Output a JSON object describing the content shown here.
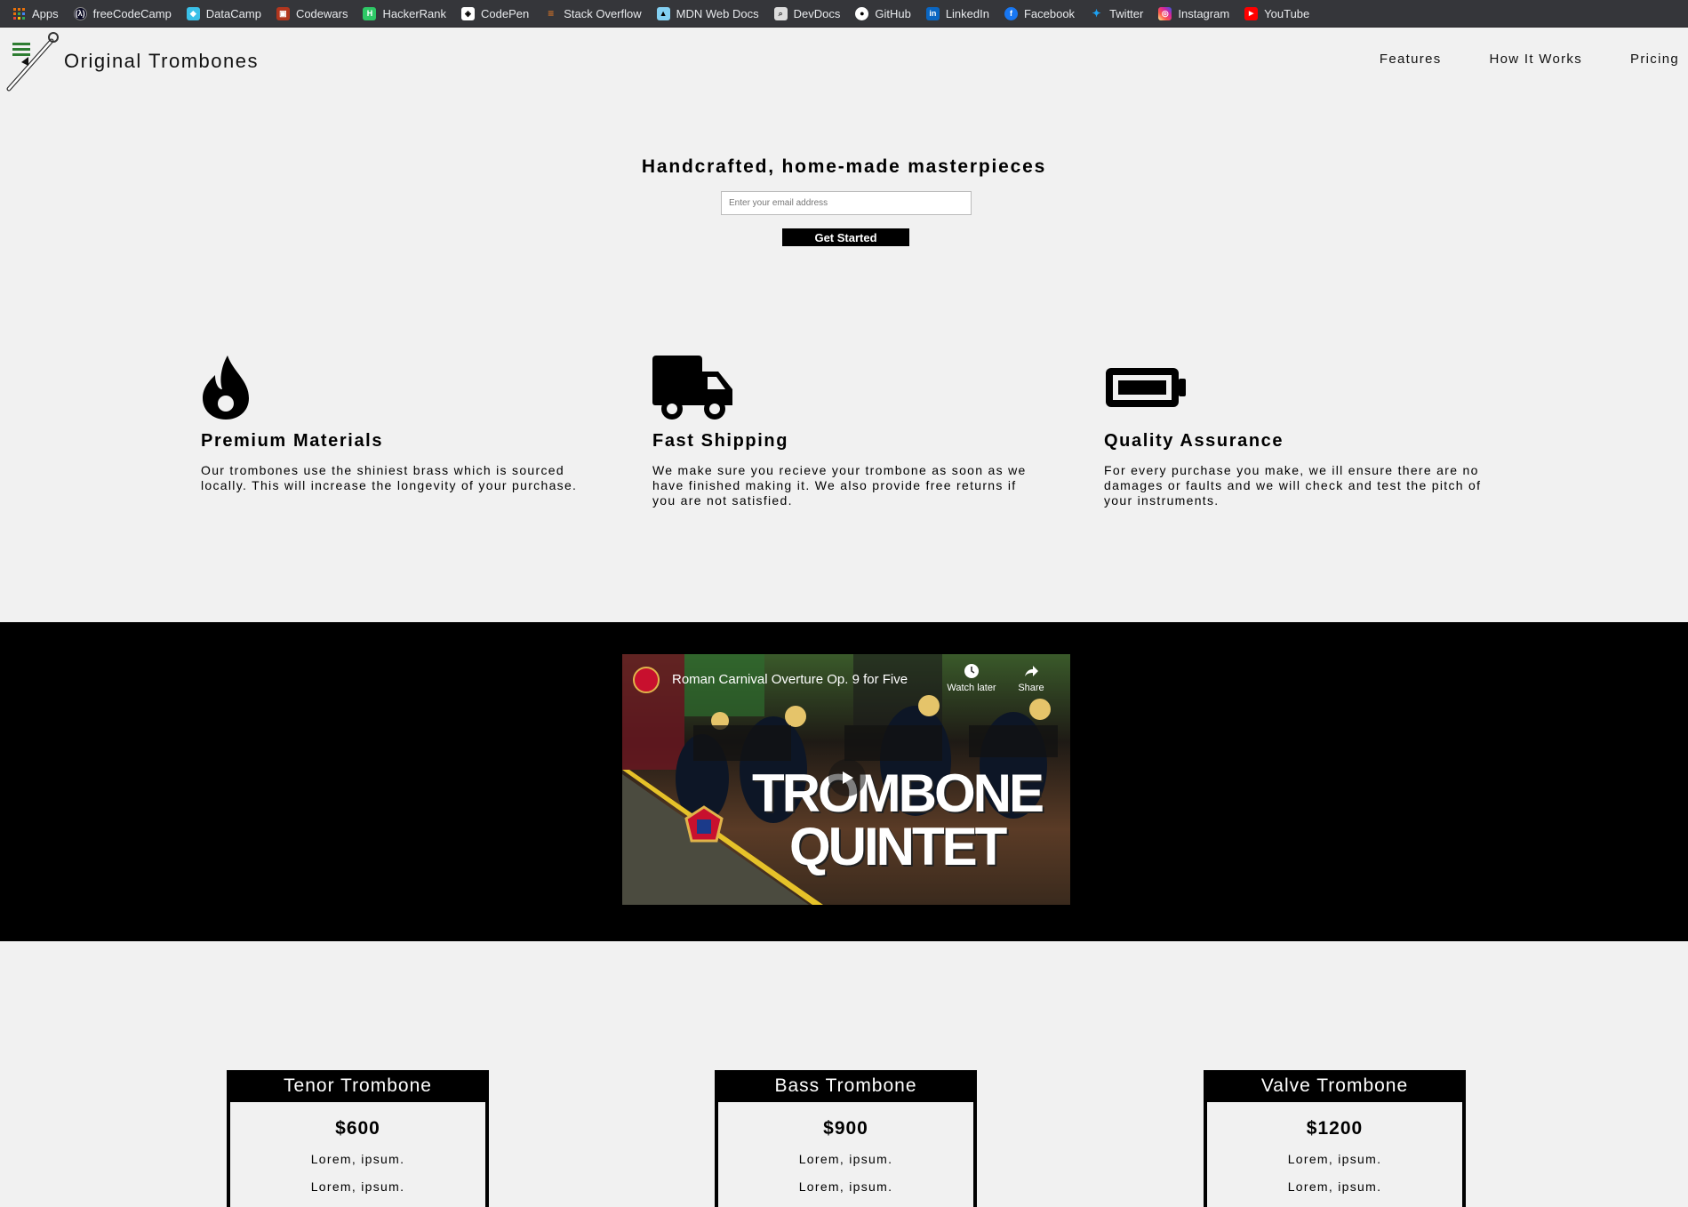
{
  "bookmarks": [
    {
      "label": "Apps",
      "icon": "apps-grid-icon",
      "color": "#e8710a"
    },
    {
      "label": "freeCodeCamp",
      "icon": "freecodecamp-icon",
      "color": "#0a0a23"
    },
    {
      "label": "DataCamp",
      "icon": "datacamp-icon",
      "color": "#3ac0e8"
    },
    {
      "label": "Codewars",
      "icon": "codewars-icon",
      "color": "#b1361e"
    },
    {
      "label": "HackerRank",
      "icon": "hackerrank-icon",
      "color": "#2ec866"
    },
    {
      "label": "CodePen",
      "icon": "codepen-icon",
      "color": "#ffffff"
    },
    {
      "label": "Stack Overflow",
      "icon": "stackoverflow-icon",
      "color": "#f48024"
    },
    {
      "label": "MDN Web Docs",
      "icon": "mdn-icon",
      "color": "#83d0f2"
    },
    {
      "label": "DevDocs",
      "icon": "devdocs-icon",
      "color": "#dddddd"
    },
    {
      "label": "GitHub",
      "icon": "github-icon",
      "color": "#ffffff"
    },
    {
      "label": "LinkedIn",
      "icon": "linkedin-icon",
      "color": "#0a66c2"
    },
    {
      "label": "Facebook",
      "icon": "facebook-icon",
      "color": "#1877f2"
    },
    {
      "label": "Twitter",
      "icon": "twitter-icon",
      "color": "#1da1f2"
    },
    {
      "label": "Instagram",
      "icon": "instagram-icon",
      "color": "#d6249f"
    },
    {
      "label": "YouTube",
      "icon": "youtube-icon",
      "color": "#ff0000"
    }
  ],
  "header": {
    "brand": "Original Trombones",
    "nav": [
      "Features",
      "How It Works",
      "Pricing"
    ]
  },
  "hero": {
    "title": "Handcrafted, home-made masterpieces",
    "email_placeholder": "Enter your email address",
    "cta_label": "Get Started"
  },
  "features": [
    {
      "icon": "fire-icon",
      "title": "Premium Materials",
      "text": "Our trombones use the shiniest brass which is sourced locally. This will increase the longevity of your purchase."
    },
    {
      "icon": "truck-icon",
      "title": "Fast Shipping",
      "text": "We make sure you recieve your trombone as soon as we have finished making it. We also provide free returns if you are not satisfied."
    },
    {
      "icon": "battery-full-icon",
      "title": "Quality Assurance",
      "text": "For every purchase you make, we ill ensure there are no damages or faults and we will check and test the pitch of your instruments."
    }
  ],
  "video": {
    "title": "Roman Carnival Overture Op. 9 for Five",
    "watch_later": "Watch later",
    "share": "Share",
    "overlay_line1": "TROMBONE",
    "overlay_line2": "QUINTET"
  },
  "pricing": [
    {
      "name": "Tenor Trombone",
      "price": "$600",
      "lines": [
        "Lorem, ipsum.",
        "Lorem, ipsum."
      ]
    },
    {
      "name": "Bass Trombone",
      "price": "$900",
      "lines": [
        "Lorem, ipsum.",
        "Lorem, ipsum."
      ]
    },
    {
      "name": "Valve Trombone",
      "price": "$1200",
      "lines": [
        "Lorem, ipsum.",
        "Lorem, ipsum."
      ]
    }
  ],
  "colors": {
    "page_bg": "#f1f1f1",
    "bookmarks_bg": "#35363a",
    "accent_dark": "#000000"
  }
}
